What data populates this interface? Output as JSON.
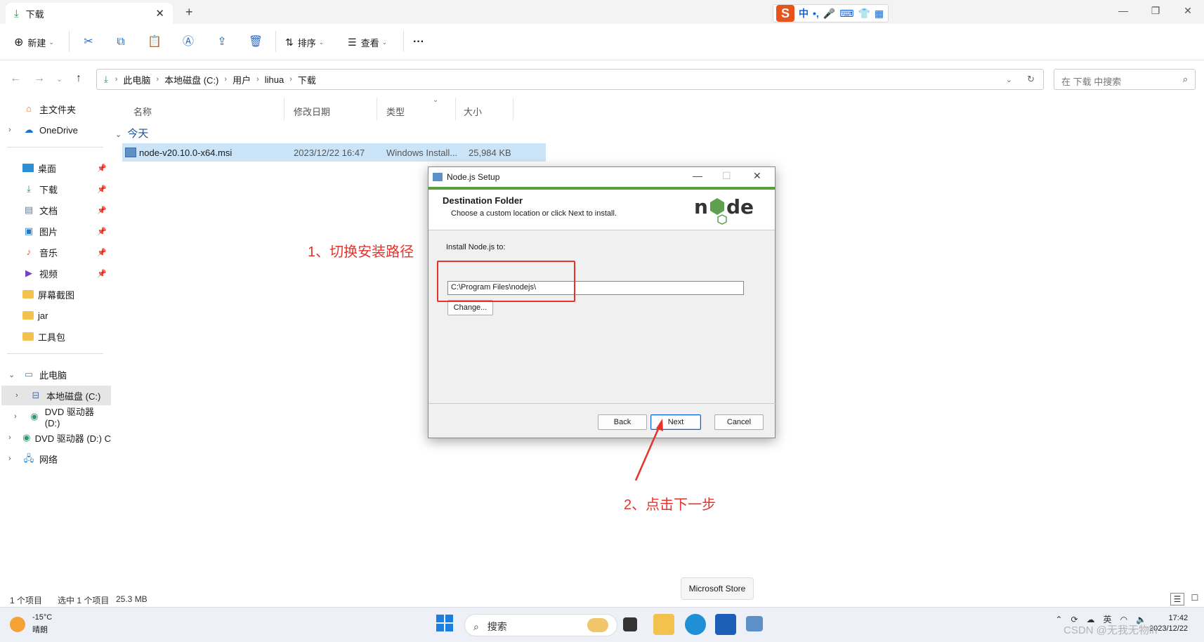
{
  "window": {
    "tab_title": "下载",
    "ime": {
      "brand": "S",
      "labels": [
        "中",
        "•,",
        "🎤",
        "⌨",
        "👕",
        "▦"
      ]
    }
  },
  "toolbar": {
    "new_label": "新建",
    "sort_label": "排序",
    "view_label": "查看",
    "more_label": "···"
  },
  "address": {
    "crumbs": [
      "此电脑",
      "本地磁盘 (C:)",
      "用户",
      "lihua",
      "下载"
    ],
    "search_placeholder": "在 下载 中搜索"
  },
  "sidebar": {
    "home": "主文件夹",
    "onedrive": "OneDrive",
    "quick": [
      "桌面",
      "下载",
      "文档",
      "图片",
      "音乐",
      "视频",
      "屏幕截图",
      "jar",
      "工具包"
    ],
    "pc": "此电脑",
    "drives": [
      "本地磁盘 (C:)",
      "DVD 驱动器 (D:)",
      "DVD 驱动器 (D:) C"
    ],
    "network": "网络"
  },
  "filelist": {
    "columns": [
      "名称",
      "修改日期",
      "类型",
      "大小"
    ],
    "group": "今天",
    "rows": [
      {
        "name": "node-v20.10.0-x64.msi",
        "date": "2023/12/22 16:47",
        "type": "Windows Install...",
        "size": "25,984 KB"
      }
    ]
  },
  "dialog": {
    "title": "Node.js Setup",
    "heading": "Destination Folder",
    "subheading": "Choose a custom location or click Next to install.",
    "install_label": "Install Node.js to:",
    "path": "C:\\Program Files\\nodejs\\",
    "change_label": "Change...",
    "back_label": "Back",
    "next_label": "Next",
    "cancel_label": "Cancel"
  },
  "annotations": {
    "step1": "1、切换安装路径",
    "step2": "2、点击下一步",
    "color": "#e8322a"
  },
  "status": {
    "count": "1 个项目",
    "selected": "选中 1 个项目",
    "size": "25.3 MB",
    "tooltip": "Microsoft Store"
  },
  "taskbar": {
    "temp": "-15°C",
    "weather": "晴朗",
    "search_label": "搜索",
    "ime_lang": "英",
    "time": "17:42",
    "date": "2023/12/22",
    "watermark": "CSDN @无我无物lh"
  }
}
